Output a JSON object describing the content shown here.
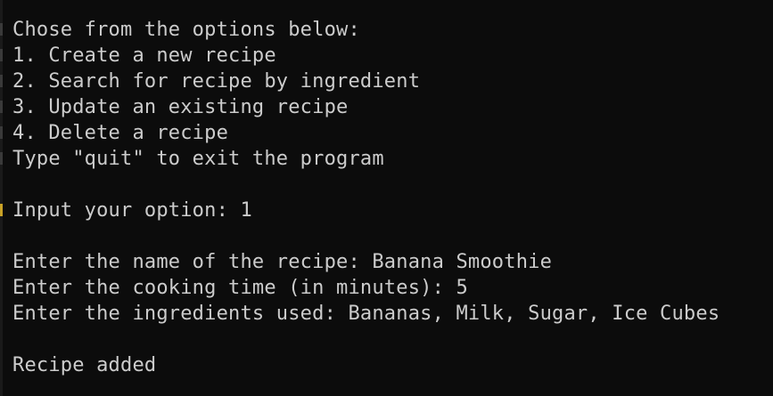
{
  "terminal": {
    "lines": [
      "Chose from the options below:",
      "1. Create a new recipe",
      "2. Search for recipe by ingredient",
      "3. Update an existing recipe",
      "4. Delete a recipe",
      "Type \"quit\" to exit the program",
      "",
      "Input your option: 1",
      "",
      "Enter the name of the recipe: Banana Smoothie",
      "Enter the cooking time (in minutes): 5",
      "Enter the ingredients used: Bananas, Milk, Sugar, Ice Cubes",
      "",
      "Recipe added"
    ]
  },
  "colors": {
    "background": "#0c0c0c",
    "foreground": "#cccccc",
    "gutter_accent": "#c9a227"
  }
}
